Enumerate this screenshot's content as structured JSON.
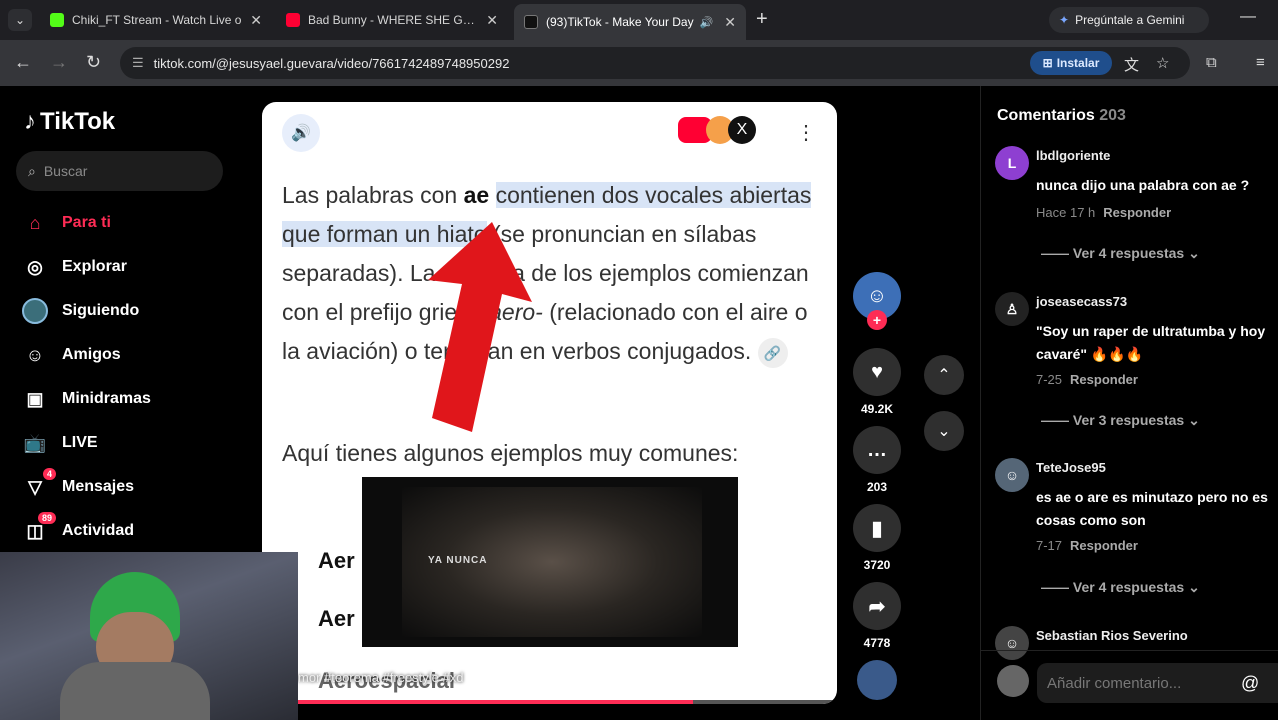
{
  "tabs": [
    {
      "title": "Chiki_FT Stream - Watch Live o",
      "favicon_color": "#53fc18"
    },
    {
      "title": "Bad Bunny - WHERE SHE GOES",
      "favicon_color": "#ff0033"
    },
    {
      "title": "(93)TikTok - Make Your Day",
      "favicon_color": "#111111"
    }
  ],
  "gemini_label": "Pregúntale a Gemini",
  "url": "tiktok.com/@jesusyael.guevara/video/7661742489748950292",
  "install_label": "Instalar",
  "brand": "TikTok",
  "search_placeholder": "Buscar",
  "nav": [
    {
      "label": "Para ti",
      "icon": "home-icon"
    },
    {
      "label": "Explorar",
      "icon": "compass-icon"
    },
    {
      "label": "Siguiendo",
      "icon": "following-icon"
    },
    {
      "label": "Amigos",
      "icon": "friends-icon"
    },
    {
      "label": "Minidramas",
      "icon": "film-icon"
    },
    {
      "label": "LIVE",
      "icon": "live-icon"
    },
    {
      "label": "Mensajes",
      "icon": "message-icon",
      "badge": "4"
    },
    {
      "label": "Actividad",
      "icon": "activity-icon",
      "badge": "89"
    }
  ],
  "video": {
    "text_pre": "Las palabras con ",
    "text_bold": "ae",
    "text_hl": "contienen dos vocales abiertas que forman un hiato",
    "text_post": " (se pronuncian en sílabas separadas). La mayoría de los ejemplos comienzan con el prefijo griego ",
    "text_italic": "aero-",
    "text_end": " (relacionado con el aire o la aviación) o terminan en verbos conjugados.",
    "para2": "Aquí tienes algunos ejemplos muy comunes:",
    "inner_caption": "YA NUNCA",
    "aer1": "Aer",
    "aer2": "Aer",
    "aer3": "Aeroespacial",
    "caption_tags": "mor #teorema #freestyle #xd",
    "progress": 0.75
  },
  "actions": {
    "likes": "49.2K",
    "comments": "203",
    "saves": "3720",
    "shares": "4778"
  },
  "comments_header": "Comentarios",
  "comments_count": "203",
  "comments": [
    {
      "user": "lbdlgoriente",
      "avatar_letter": "L",
      "avatar_color": "#8e3fd1",
      "text": "nunca dijo una palabra con ae ?",
      "time": "Hace 17 h",
      "reply": "Responder",
      "replies": "Ver 4 respuestas"
    },
    {
      "user": "joseasecass73",
      "avatar_letter": "",
      "avatar_color": "#222222",
      "text": "\"Soy un raper de ultratumba y hoy cavaré\" 🔥🔥🔥",
      "time": "7-25",
      "reply": "Responder",
      "replies": "Ver 3 respuestas"
    },
    {
      "user": "TeteJose95",
      "avatar_letter": "",
      "avatar_color": "#556677",
      "text": "es ae o are es minutazo pero no es cosas como son",
      "time": "7-17",
      "reply": "Responder",
      "replies": "Ver 4 respuestas"
    },
    {
      "user": "Sebastian Rios Severino",
      "avatar_letter": "",
      "avatar_color": "#444444",
      "text": "",
      "time": "",
      "reply": "",
      "replies": ""
    }
  ],
  "add_comment_placeholder": "Añadir comentario..."
}
